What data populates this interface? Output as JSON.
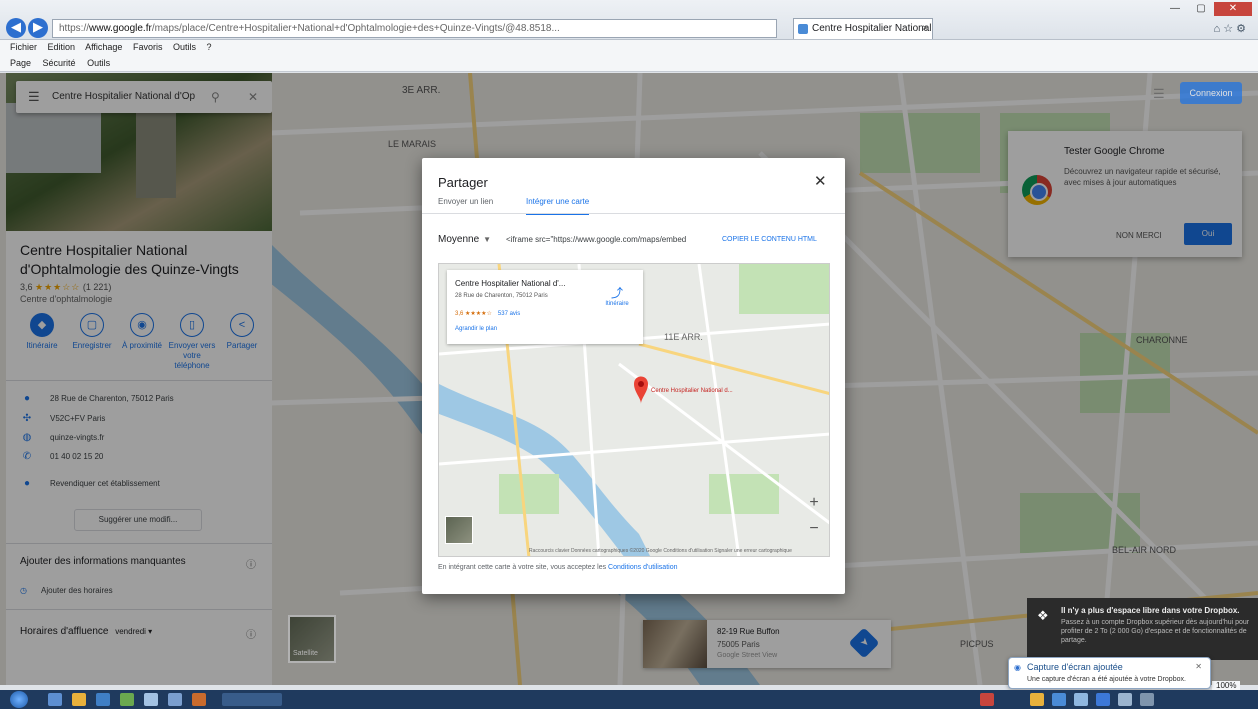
{
  "browser": {
    "url_prefix": "https://",
    "url_domain": "www.google.fr",
    "url_rest": "/maps/place/Centre+Hospitalier+National+d'Ophtalmologie+des+Quinze-Vingts/@48.8518...",
    "tab_title": "Centre Hospitalier National ...",
    "menu": [
      "Fichier",
      "Edition",
      "Affichage",
      "Favoris",
      "Outils",
      "?"
    ],
    "commands": [
      "Page",
      "Sécurité",
      "Outils"
    ],
    "zoom": "100%"
  },
  "panel": {
    "search_value": "Centre Hospitalier National d'Op",
    "title": "Centre Hospitalier National d'Ophtalmologie des Quinze-Vingts",
    "rating_value": "3,6",
    "rating_stars": "★★★☆☆",
    "rating_count": "(1 221)",
    "category": "Centre d'ophtalmologie",
    "actions": [
      {
        "label": "Itinéraire",
        "icon": "◆"
      },
      {
        "label": "Enregistrer",
        "icon": "▢"
      },
      {
        "label": "À proximité",
        "icon": "◉"
      },
      {
        "label": "Envoyer vers votre téléphone",
        "icon": "▯"
      },
      {
        "label": "Partager",
        "icon": "<"
      }
    ],
    "info": [
      {
        "icon": "●",
        "text": "28 Rue de Charenton, 75012 Paris"
      },
      {
        "icon": "✣",
        "text": "V52C+FV Paris"
      },
      {
        "icon": "◍",
        "text": "quinze-vingts.fr"
      },
      {
        "icon": "✆",
        "text": "01 40 02 15 20"
      },
      {
        "icon": "●",
        "text": "Revendiquer cet établissement"
      }
    ],
    "suggest_label": "Suggérer une modifi...",
    "missing_title": "Ajouter des informations manquantes",
    "missing_item": "Ajouter des horaires",
    "busy_title": "Horaires d'affluence",
    "busy_day": "vendredi ▾"
  },
  "header": {
    "signin_label": "Connexion"
  },
  "chrome_promo": {
    "title": "Tester Google Chrome",
    "desc": "Découvrez un navigateur rapide et sécurisé, avec mises à jour automatiques",
    "no_label": "NON MERCI",
    "yes_label": "Oui"
  },
  "share_dialog": {
    "title": "Partager",
    "tabs": [
      "Envoyer un lien",
      "Intégrer une carte"
    ],
    "active_tab": 1,
    "size": "Moyenne",
    "embed_code": "<iframe src=\"https://www.google.com/maps/embed",
    "copy_label": "COPIER LE CONTENU HTML",
    "preview": {
      "place_name": "Centre Hospitalier National d'...",
      "address": "28 Rue de Charenton, 75012 Paris",
      "rating": "3,6 ★★★★☆",
      "reviews": "537 avis",
      "larger_map": "Agrandir le plan",
      "directions": "Itinéraire",
      "pin_label": "Centre Hospitalier National d...",
      "credit": "Raccourcis clavier  Données cartographiques ©2020 Google  Conditions d'utilisation  Signaler une erreur cartographique"
    },
    "terms_prefix": "En intégrant cette carte à votre site, vous acceptez les ",
    "terms_link": "Conditions d'utilisation"
  },
  "map_labels": [
    {
      "text": "3E ARR."
    },
    {
      "text": "LE MARAIS"
    },
    {
      "text": "11E ARR."
    },
    {
      "text": "CHARONNE"
    },
    {
      "text": "BEL-AIR NORD"
    },
    {
      "text": "PICPUS"
    }
  ],
  "streetview": {
    "address": "82-19 Rue Buffon",
    "city": "75005 Paris",
    "meta": "Google Street View"
  },
  "layers_label": "Satellite",
  "dropbox_toast": {
    "title": "Il n'y a plus d'espace libre dans votre Dropbox.",
    "desc": "Passez à un compte Dropbox supérieur dès aujourd'hui pour profiter de 2 To (2 000 Go) d'espace et de fonctionnalités de partage."
  },
  "capture_toast": {
    "title": "Capture d'écran ajoutée",
    "desc": "Une capture d'écran a été ajoutée à votre Dropbox."
  },
  "colors": {
    "accent": "#1a73e8",
    "water": "#9ec8e4",
    "park": "#c3e2b5",
    "pin": "#ea4335"
  }
}
